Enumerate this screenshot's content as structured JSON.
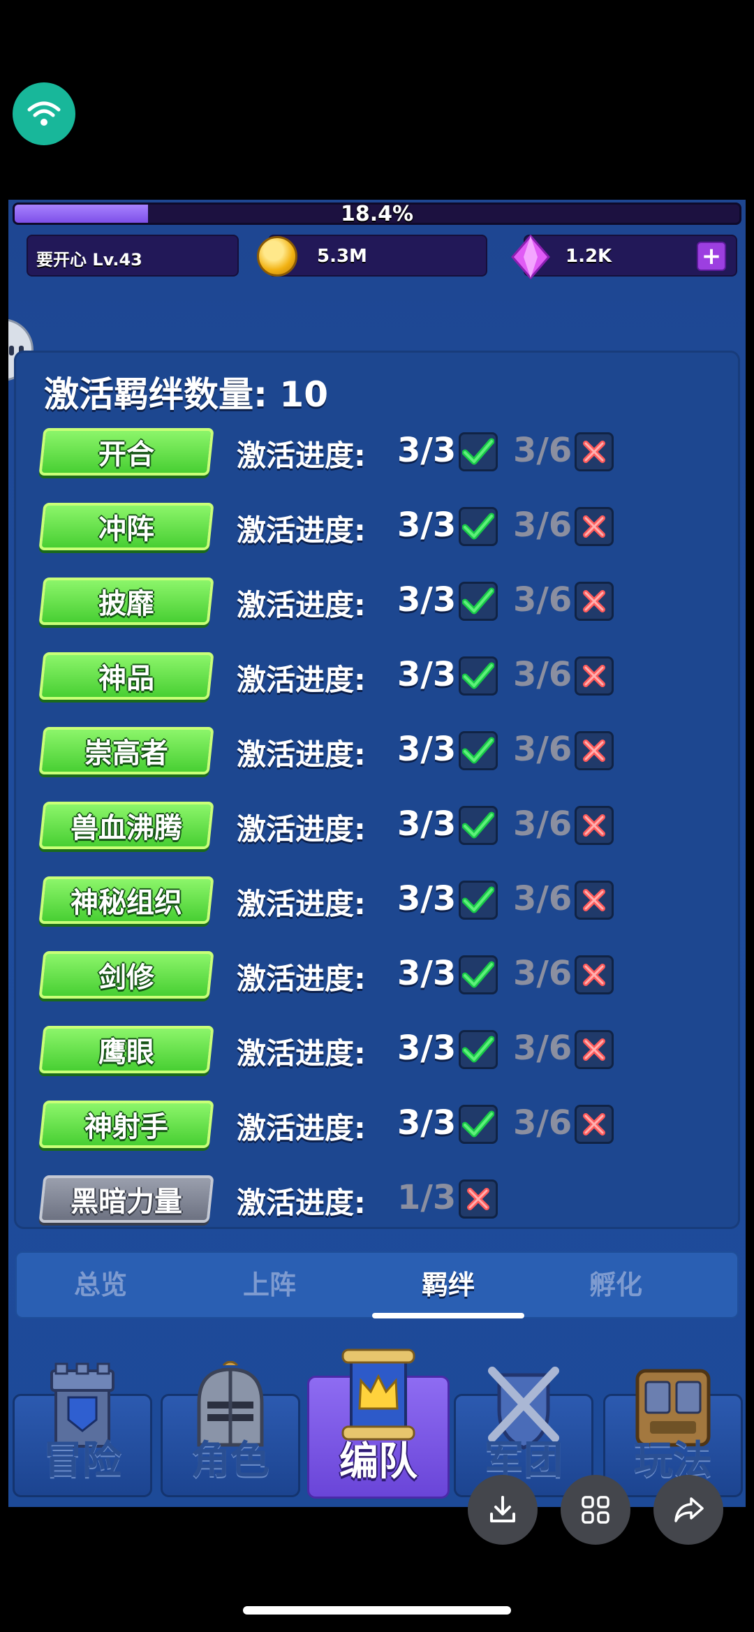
{
  "status": {
    "wifi_icon": "wifi-icon"
  },
  "header": {
    "xp_percent": "18.4%",
    "xp_progress": 0.184,
    "player": "要开心 Lv.43",
    "coins": "5.3M",
    "gems": "1.2K",
    "plus": "+"
  },
  "bond_panel": {
    "title": "激活羁绊数量: 10",
    "progress_label": "激活进度:",
    "rows": [
      {
        "name": "开合",
        "current": "3/3",
        "next": "3/6",
        "active": true
      },
      {
        "name": "冲阵",
        "current": "3/3",
        "next": "3/6",
        "active": true
      },
      {
        "name": "披靡",
        "current": "3/3",
        "next": "3/6",
        "active": true
      },
      {
        "name": "神品",
        "current": "3/3",
        "next": "3/6",
        "active": true
      },
      {
        "name": "崇高者",
        "current": "3/3",
        "next": "3/6",
        "active": true
      },
      {
        "name": "兽血沸腾",
        "current": "3/3",
        "next": "3/6",
        "active": true
      },
      {
        "name": "神秘组织",
        "current": "3/3",
        "next": "3/6",
        "active": true
      },
      {
        "name": "剑修",
        "current": "3/3",
        "next": "3/6",
        "active": true
      },
      {
        "name": "鹰眼",
        "current": "3/3",
        "next": "3/6",
        "active": true
      },
      {
        "name": "神射手",
        "current": "3/3",
        "next": "3/6",
        "active": true
      },
      {
        "name": "黑暗力量",
        "current": "1/3",
        "next": "",
        "active": false
      }
    ]
  },
  "tabs": [
    {
      "label": "总览",
      "active": false
    },
    {
      "label": "上阵",
      "active": false
    },
    {
      "label": "羁绊",
      "active": true
    },
    {
      "label": "孵化",
      "active": false
    }
  ],
  "bottom_nav": [
    {
      "label": "冒险",
      "icon": "tower-icon",
      "active": false
    },
    {
      "label": "角色",
      "icon": "knight-helmet-icon",
      "active": false
    },
    {
      "label": "编队",
      "icon": "crown-banner-icon",
      "active": true
    },
    {
      "label": "军团",
      "icon": "crossed-swords-shield-icon",
      "active": false
    },
    {
      "label": "玩法",
      "icon": "slot-machine-icon",
      "active": false
    }
  ],
  "overlay_buttons": [
    "download-icon",
    "grid-icon",
    "share-icon"
  ],
  "colors": {
    "accent_green": "#48cf33",
    "panel_blue": "#1d4790",
    "active_purple": "#7e4fe8"
  }
}
